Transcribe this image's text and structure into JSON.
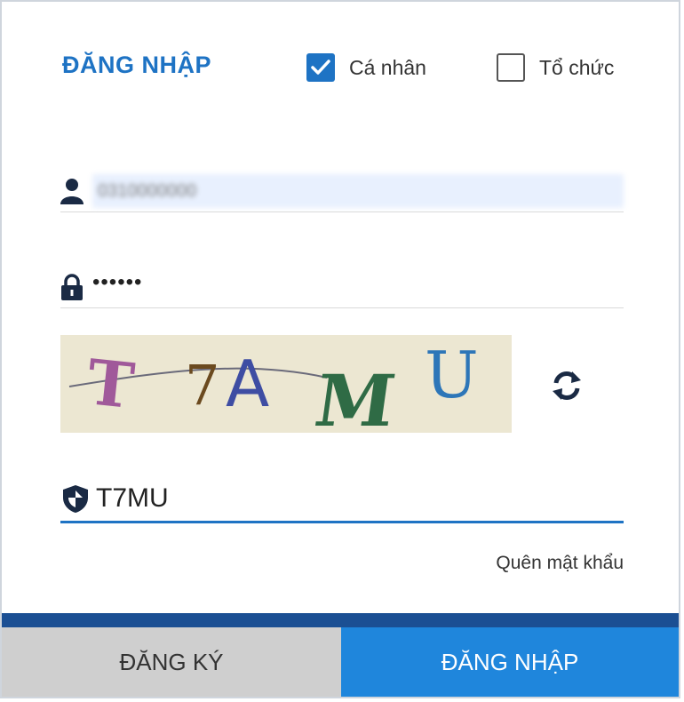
{
  "form": {
    "title": "ĐĂNG NHẬP",
    "account_types": [
      {
        "label": "Cá nhân",
        "checked": true
      },
      {
        "label": "Tổ chức",
        "checked": false
      }
    ],
    "username": {
      "value": "0310000000"
    },
    "password": {
      "masked_value": "••••••"
    },
    "captcha": {
      "text": "T7AMU",
      "refresh_icon": "refresh-icon"
    },
    "captcha_input": {
      "value": "T7MU"
    },
    "forgot_password": "Quên mật khẩu",
    "buttons": {
      "register": "ĐĂNG KÝ",
      "login": "ĐĂNG NHẬP"
    }
  },
  "colors": {
    "primary": "#1e73c4",
    "login_button": "#1f86dc",
    "register_button": "#cfcfcf",
    "stripe": "#1b4f93",
    "captcha_bg": "#ece7d2"
  }
}
